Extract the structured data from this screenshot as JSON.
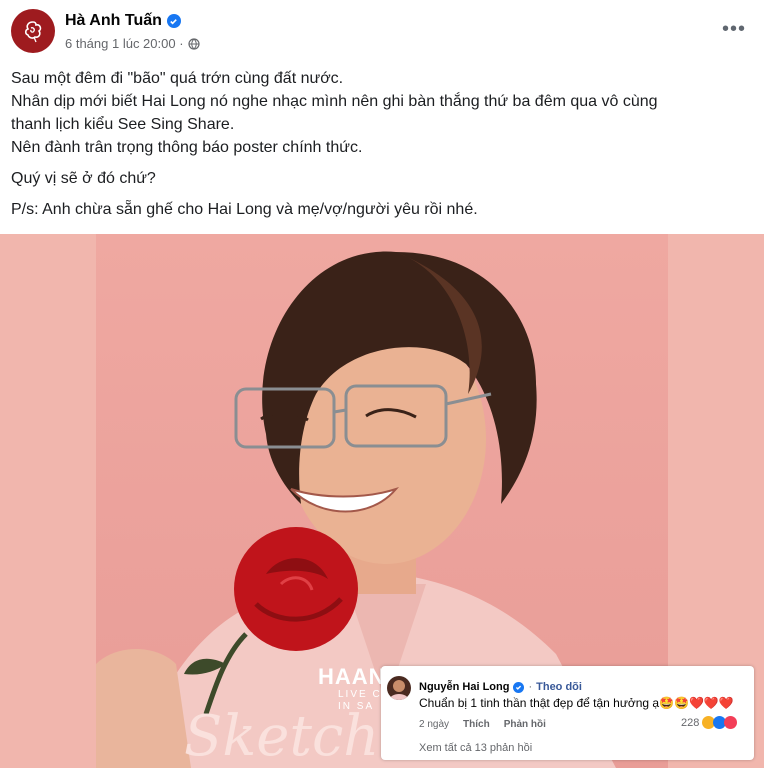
{
  "post": {
    "author": "Hà Anh Tuấn",
    "meta_time": "6 tháng 1 lúc 20:00 ·",
    "more_label": "•••",
    "lines": [
      "Sau một đêm đi \"bão\" quá trớn cùng đất nước.",
      "Nhân dịp mới biết Hai Long nó nghe nhạc mình nên ghi bàn thắng thứ ba đêm qua vô cùng",
      "thanh lịch kiểu See Sing Share.",
      "Nên đành trân trọng thông báo poster chính thức.",
      "Quý vị sẽ ở đó chứ?",
      "P/s: Anh chừa sẵn ghế cho Hai Long và mẹ/vợ/người yêu rồi nhé."
    ]
  },
  "poster": {
    "brand": "HAANH",
    "sub1": "LIVE C",
    "sub2": "IN SA",
    "script": "Sketch a Rose"
  },
  "comment": {
    "name": "Nguyễn Hai Long",
    "follow": "Theo dõi",
    "text": "Chuẩn bị 1 tinh thần thật đẹp để tận hưởng ạ🤩🤩❤️❤️❤️",
    "time": "2 ngày",
    "like": "Thích",
    "reply": "Phản hồi",
    "reaction_count": "228",
    "more_replies": "Xem tất cả 13 phản hồi"
  },
  "colors": {
    "verified": "#1877f2",
    "avatar_bg": "#9e1b1f",
    "poster_bg": "#efa8a1",
    "rose": "#c0141b"
  }
}
